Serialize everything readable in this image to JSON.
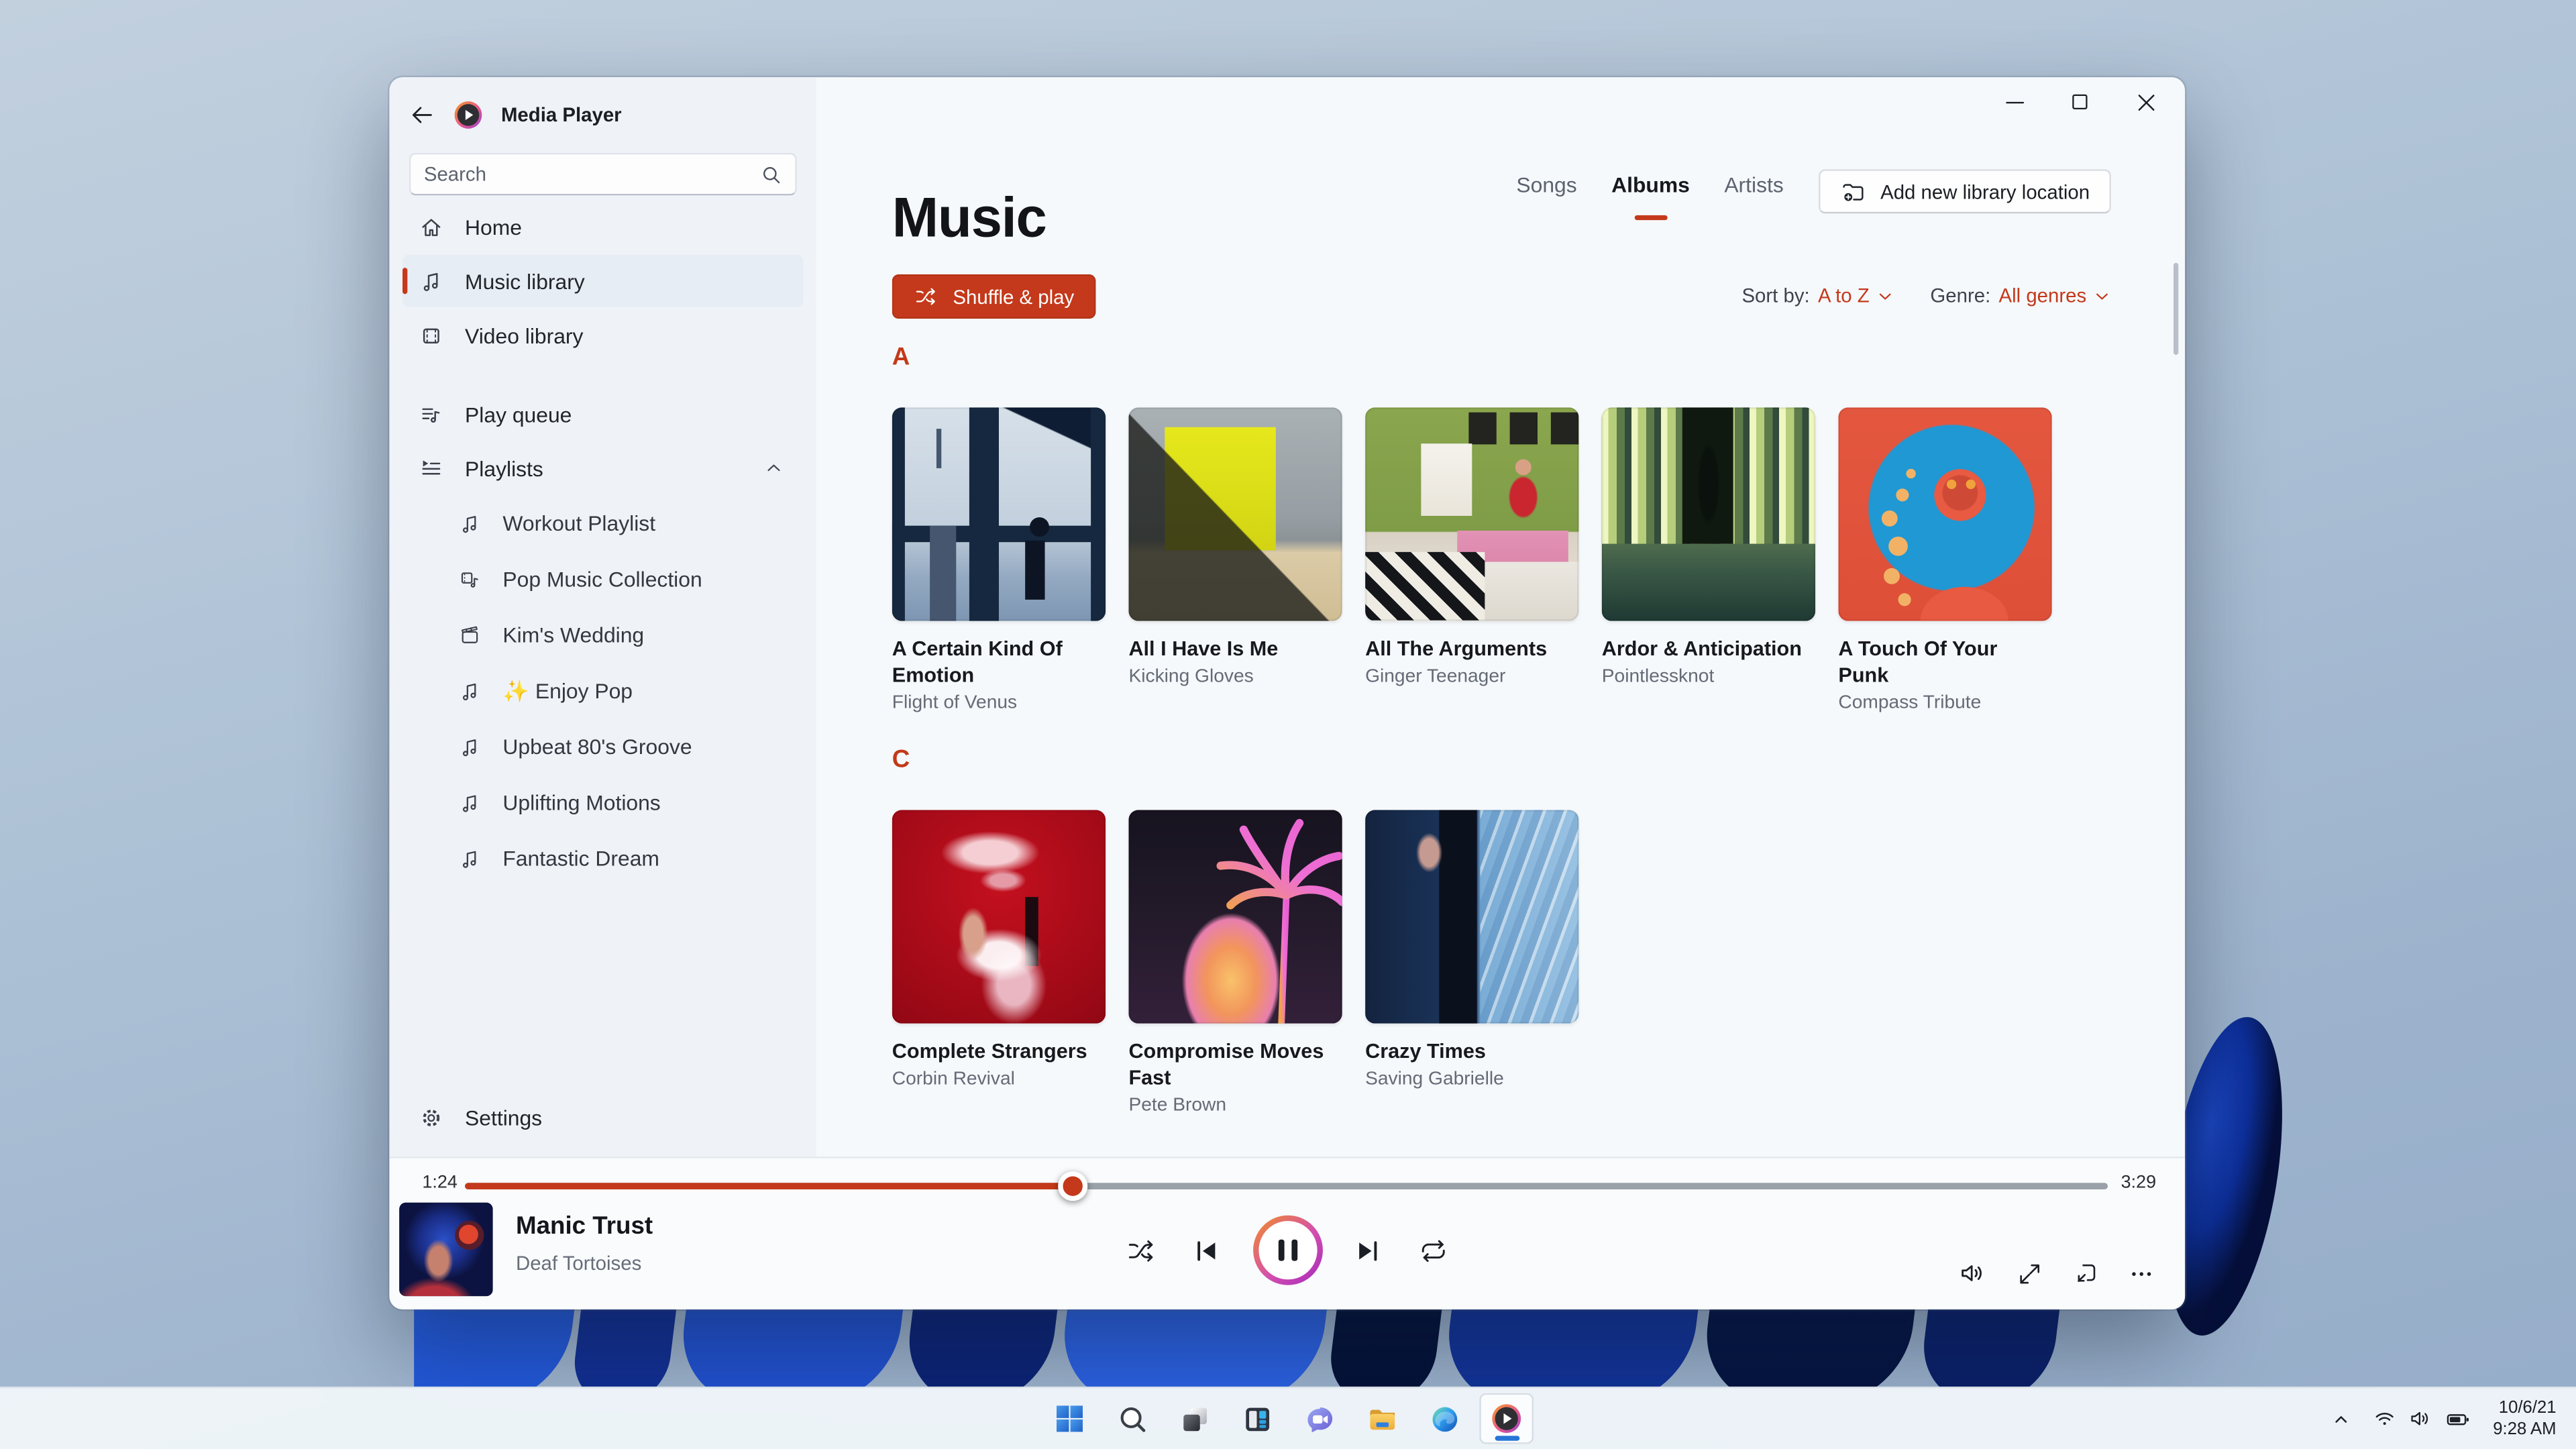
{
  "colors": {
    "accent": "#c4391b",
    "taskbar_indicator": "#2776d8"
  },
  "window": {
    "title": "Media Player"
  },
  "sidebar": {
    "search_placeholder": "Search",
    "items": [
      {
        "label": "Home",
        "icon": "home-icon"
      },
      {
        "label": "Music library",
        "icon": "music-note-icon",
        "selected": true
      },
      {
        "label": "Video library",
        "icon": "video-icon"
      },
      {
        "label": "Play queue",
        "icon": "play-queue-icon"
      },
      {
        "label": "Playlists",
        "icon": "playlists-icon",
        "expanded": true
      }
    ],
    "playlists": [
      {
        "label": "Workout Playlist",
        "icon": "music-note-icon"
      },
      {
        "label": "Pop Music Collection",
        "icon": "music-video-icon"
      },
      {
        "label": "Kim's Wedding",
        "icon": "clapperboard-icon"
      },
      {
        "label": "✨ Enjoy Pop",
        "icon": "music-note-icon"
      },
      {
        "label": "Upbeat 80's Groove",
        "icon": "music-note-icon"
      },
      {
        "label": "Uplifting Motions",
        "icon": "music-note-icon"
      },
      {
        "label": "Fantastic Dream",
        "icon": "music-note-icon"
      }
    ],
    "settings_label": "Settings"
  },
  "header": {
    "page_title": "Music",
    "tabs": [
      {
        "label": "Songs"
      },
      {
        "label": "Albums",
        "selected": true
      },
      {
        "label": "Artists"
      }
    ],
    "add_library_label": "Add new library location"
  },
  "toolbar": {
    "shuffle_play_label": "Shuffle & play",
    "sort_by_label": "Sort by:",
    "sort_by_value": "A to Z",
    "genre_label": "Genre:",
    "genre_value": "All genres"
  },
  "library": {
    "sections": [
      {
        "letter": "A",
        "albums": [
          {
            "title": "A Certain Kind Of Emotion",
            "artist": "Flight of Venus"
          },
          {
            "title": "All I Have Is Me",
            "artist": "Kicking Gloves"
          },
          {
            "title": "All The Arguments",
            "artist": "Ginger Teenager"
          },
          {
            "title": "Ardor & Anticipation",
            "artist": "Pointlessknot"
          },
          {
            "title": "A Touch Of Your Punk",
            "artist": "Compass Tribute"
          }
        ]
      },
      {
        "letter": "C",
        "albums": [
          {
            "title": "Complete Strangers",
            "artist": "Corbin Revival"
          },
          {
            "title": "Compromise Moves Fast",
            "artist": "Pete Brown"
          },
          {
            "title": "Crazy Times",
            "artist": "Saving Gabrielle"
          }
        ]
      }
    ]
  },
  "player": {
    "elapsed": "1:24",
    "duration": "3:29",
    "progress_percent": 37,
    "track_title": "Manic Trust",
    "track_artist": "Deaf Tortoises",
    "state": "playing"
  },
  "taskbar": {
    "icons": [
      "start",
      "search",
      "task-view",
      "widgets",
      "chat",
      "file-explorer",
      "edge",
      "media-player"
    ],
    "active_icon": "media-player",
    "tray_date": "10/6/21",
    "tray_time": "9:28 AM"
  }
}
